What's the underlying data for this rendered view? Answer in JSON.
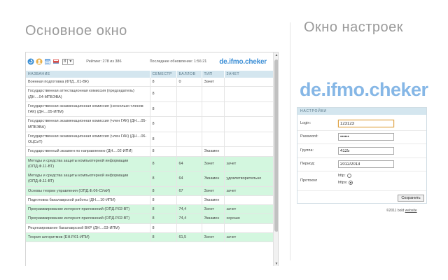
{
  "headings": {
    "main": "Основное окно",
    "settings": "Окно настроек"
  },
  "toolbar": {
    "semester": "8",
    "rating": "Рейтинг: 278 из 386",
    "updated": "Последнее обновление: 1:56:21",
    "logo": "de.ifmo.cheker"
  },
  "table": {
    "columns": [
      "НАЗВАНИЕ",
      "СЕМЕСТР",
      "БАЛЛОВ",
      "ТИП",
      "ЗАЧЕТ"
    ],
    "rows": [
      {
        "name": "Военная подготовка (ФТД...01-ВК)",
        "sem": "8",
        "points": "0",
        "type": "Зачет",
        "result": "",
        "green": false
      },
      {
        "name": "Государственная аттестационная комиссия (председатель) (ДН....04-МПБЭВА)",
        "sem": "8",
        "points": "",
        "type": "",
        "result": "",
        "green": false
      },
      {
        "name": "Государственная экзаменационная комиссия (несколько членов ГАК) (ДН....05-ИПМ)",
        "sem": "8",
        "points": "",
        "type": "",
        "result": "",
        "green": false
      },
      {
        "name": "Государственная экзаменационная комиссия (член ГАК) (ДН....05-МПБЭВА)",
        "sem": "8",
        "points": "",
        "type": "",
        "result": "",
        "green": false
      },
      {
        "name": "Государственная экзаменационная комиссия (член ГАК) (ДН....06-ОЦСиТ)",
        "sem": "8",
        "points": "",
        "type": "",
        "result": "",
        "green": false
      },
      {
        "name": "Государственный экзамен по направлению (ДН....02-ИПИ)",
        "sem": "8",
        "points": "",
        "type": "Экзамен",
        "result": "",
        "green": false
      },
      {
        "name": "Методы и средства защиты компьютерной информации (ОПД.Ф.11-ВТ)",
        "sem": "8",
        "points": "64",
        "type": "Зачет",
        "result": "зачет",
        "green": true
      },
      {
        "name": "Методы и средства защиты компьютерной информации (ОПД.Ф.11-ВТ)",
        "sem": "8",
        "points": "64",
        "type": "Экзамен",
        "result": "удовлетворительно",
        "green": true
      },
      {
        "name": "Основы теории управления (ОПД.Ф.06-СУиИ)",
        "sem": "8",
        "points": "67",
        "type": "Зачет",
        "result": "зачет",
        "green": true
      },
      {
        "name": "Подготовка бакалаврской работы (ДН....10-ИПИ)",
        "sem": "8",
        "points": "",
        "type": "Экзамен",
        "result": "",
        "green": false
      },
      {
        "name": "Программирование интернет-приложений (ОПД.Р.02-ВТ)",
        "sem": "8",
        "points": "74,4",
        "type": "Зачет",
        "result": "зачет",
        "green": true
      },
      {
        "name": "Программирование интернет-приложений (ОПД.Р.02-ВТ)",
        "sem": "8",
        "points": "74,4",
        "type": "Экзамен",
        "result": "хорошо",
        "green": true
      },
      {
        "name": "Рецензирование бакалаврской ВКР (ДН....03-ИПМ)",
        "sem": "8",
        "points": "",
        "type": "",
        "result": "",
        "green": false
      },
      {
        "name": "Теория алгоритмов (ЕН.Р.01-ИПИ)",
        "sem": "8",
        "points": "61,5",
        "type": "Зачет",
        "result": "зачет",
        "green": true
      }
    ]
  },
  "settings": {
    "logo": "de.ifmo.cheker",
    "header": "НАСТРОЙКИ",
    "login_label": "Login:",
    "login_value": "123123",
    "password_label": "Password:",
    "password_value": "••••••",
    "group_label": "Группа:",
    "group_value": "4125",
    "period_label": "Период:",
    "period_value": "2012/2013",
    "protocol_label": "Протокол",
    "http_label": "http:",
    "https_label": "https:",
    "protocol_selected": "https",
    "save_label": "Сохранить"
  },
  "footer": {
    "copyright": "©2011 bold",
    "link": "website"
  },
  "colors": {
    "accent": "#3d8fd6",
    "green_row": "#d3f7df",
    "header_bg": "#d4e6ef"
  },
  "icons": [
    "refresh-icon",
    "user-icon",
    "calendar-icon",
    "book-icon"
  ]
}
